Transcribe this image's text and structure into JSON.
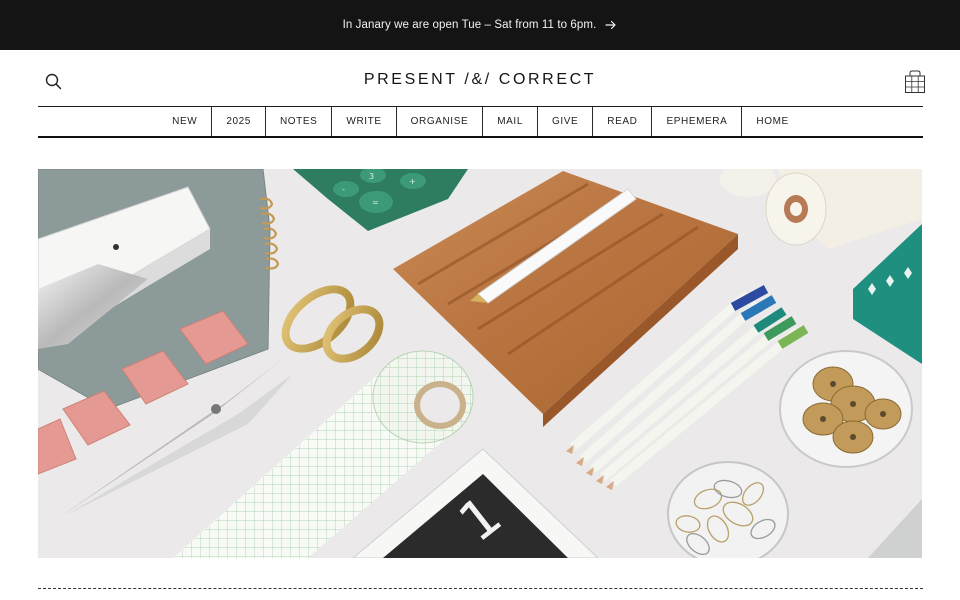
{
  "announcement": {
    "text": "In Janary we are open Tue – Sat from 11 to 6pm.",
    "arrow_icon": "arrow-right-icon"
  },
  "header": {
    "logo": "PRESENT /&/ CORRECT",
    "search_icon": "search-icon",
    "bag_icon": "shopping-bag-icon"
  },
  "nav": {
    "items": [
      {
        "label": "NEW"
      },
      {
        "label": "2025"
      },
      {
        "label": "NOTES"
      },
      {
        "label": "WRITE"
      },
      {
        "label": "ORGANISE"
      },
      {
        "label": "MAIL"
      },
      {
        "label": "GIVE"
      },
      {
        "label": "READ"
      },
      {
        "label": "EPHEMERA"
      },
      {
        "label": "HOME"
      }
    ]
  },
  "hero": {
    "calculator_keys": [
      "-",
      "3",
      "+",
      "="
    ],
    "card_number": "1"
  },
  "colors": {
    "announcement_bg": "#141414",
    "page_bg": "#ffffff",
    "hero_bg": "#eceaea"
  }
}
